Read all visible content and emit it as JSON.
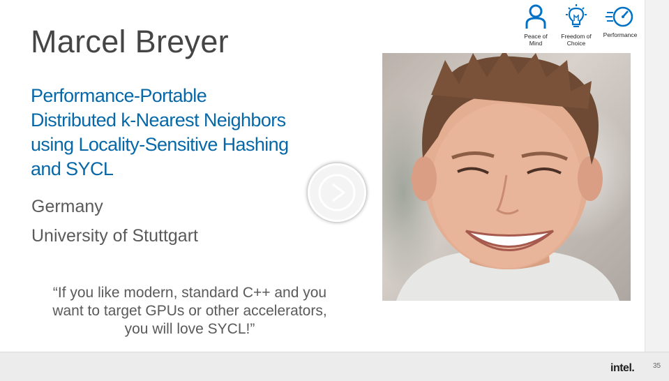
{
  "speaker": {
    "name": "Marcel Breyer",
    "talk_title_lines": [
      "Performance-Portable",
      "Distributed k-Nearest Neighbors",
      "using Locality-Sensitive Hashing",
      "and SYCL"
    ],
    "country": "Germany",
    "university": "University of Stuttgart",
    "quote_lines": [
      "“If you like modern, standard C++ and you",
      "want to target GPUs or other accelerators,",
      "you will love SYCL!”"
    ]
  },
  "badges": [
    {
      "label_lines": [
        "Peace of",
        "Mind"
      ],
      "icon": "person-icon"
    },
    {
      "label_lines": [
        "Freedom of",
        "Choice"
      ],
      "icon": "lightbulb-icon"
    },
    {
      "label_lines": [
        "Performance"
      ],
      "icon": "speedometer-icon"
    }
  ],
  "footer": {
    "logo": "intel.",
    "page_number": "35"
  },
  "colors": {
    "title_blue": "#0768a8",
    "icon_blue": "#0071c5",
    "text_gray": "#5a5a5a"
  }
}
